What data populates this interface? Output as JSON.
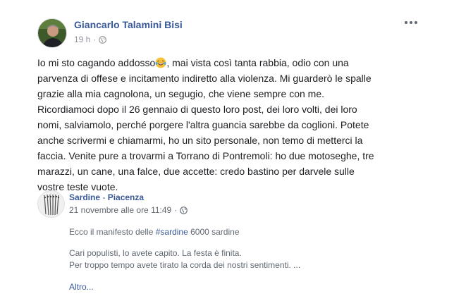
{
  "post": {
    "author": "Giancarlo Talamini Bisi",
    "time": "19 h",
    "sep": "·",
    "privacy_icon": "globe-icon",
    "more_icon": "more-options-icon",
    "lines": [
      "Io mi sto cagando addosso",
      "parvenza di offese e incitamento indiretto alla violenza. Mi guarderò le spalle",
      "grazie alla mia cagnolona, un segugio, che viene sempre con me.",
      "Ricordiamoci dopo il 26 gennaio di questo loro post, dei loro volti, dei loro",
      "nomi, salviamolo, perché porgere l'altra guancia sarebbe da coglioni. Potete",
      "anche scrivermi e chiamarmi, ho un sito personale, non temo di metterci la",
      "faccia. Venite pure a trovarmi a Torrano di Pontremoli: ho due motoseghe, tre",
      "marazzi, un cane, una falce, due accette: credo bastino per darvele sulle",
      "vostre teste vuote."
    ],
    "line1_after_emoji": ", mai vista così tanta rabbia, odio con una",
    "emoji_icon": "laughing-tears-emoji-icon"
  },
  "shared": {
    "page_name": "Sardine",
    "page_sep": " - ",
    "page_location": "Piacenza",
    "date": "21 novembre alle ore 11:49",
    "sep": "·",
    "privacy_icon": "globe-icon",
    "intro_prefix": "Ecco il manifesto delle ",
    "hashtag": "#sardine",
    "intro_suffix": " 6000 sardine",
    "para_lines": [
      "Cari populisti, lo avete capito. La festa è finita.",
      "Per troppo tempo avete tirato la corda dei nostri sentimenti. ..."
    ],
    "more_label": "Altro..."
  },
  "colors": {
    "link": "#385898",
    "text": "#1c1e21",
    "meta": "#90949c",
    "muted": "#606770"
  }
}
